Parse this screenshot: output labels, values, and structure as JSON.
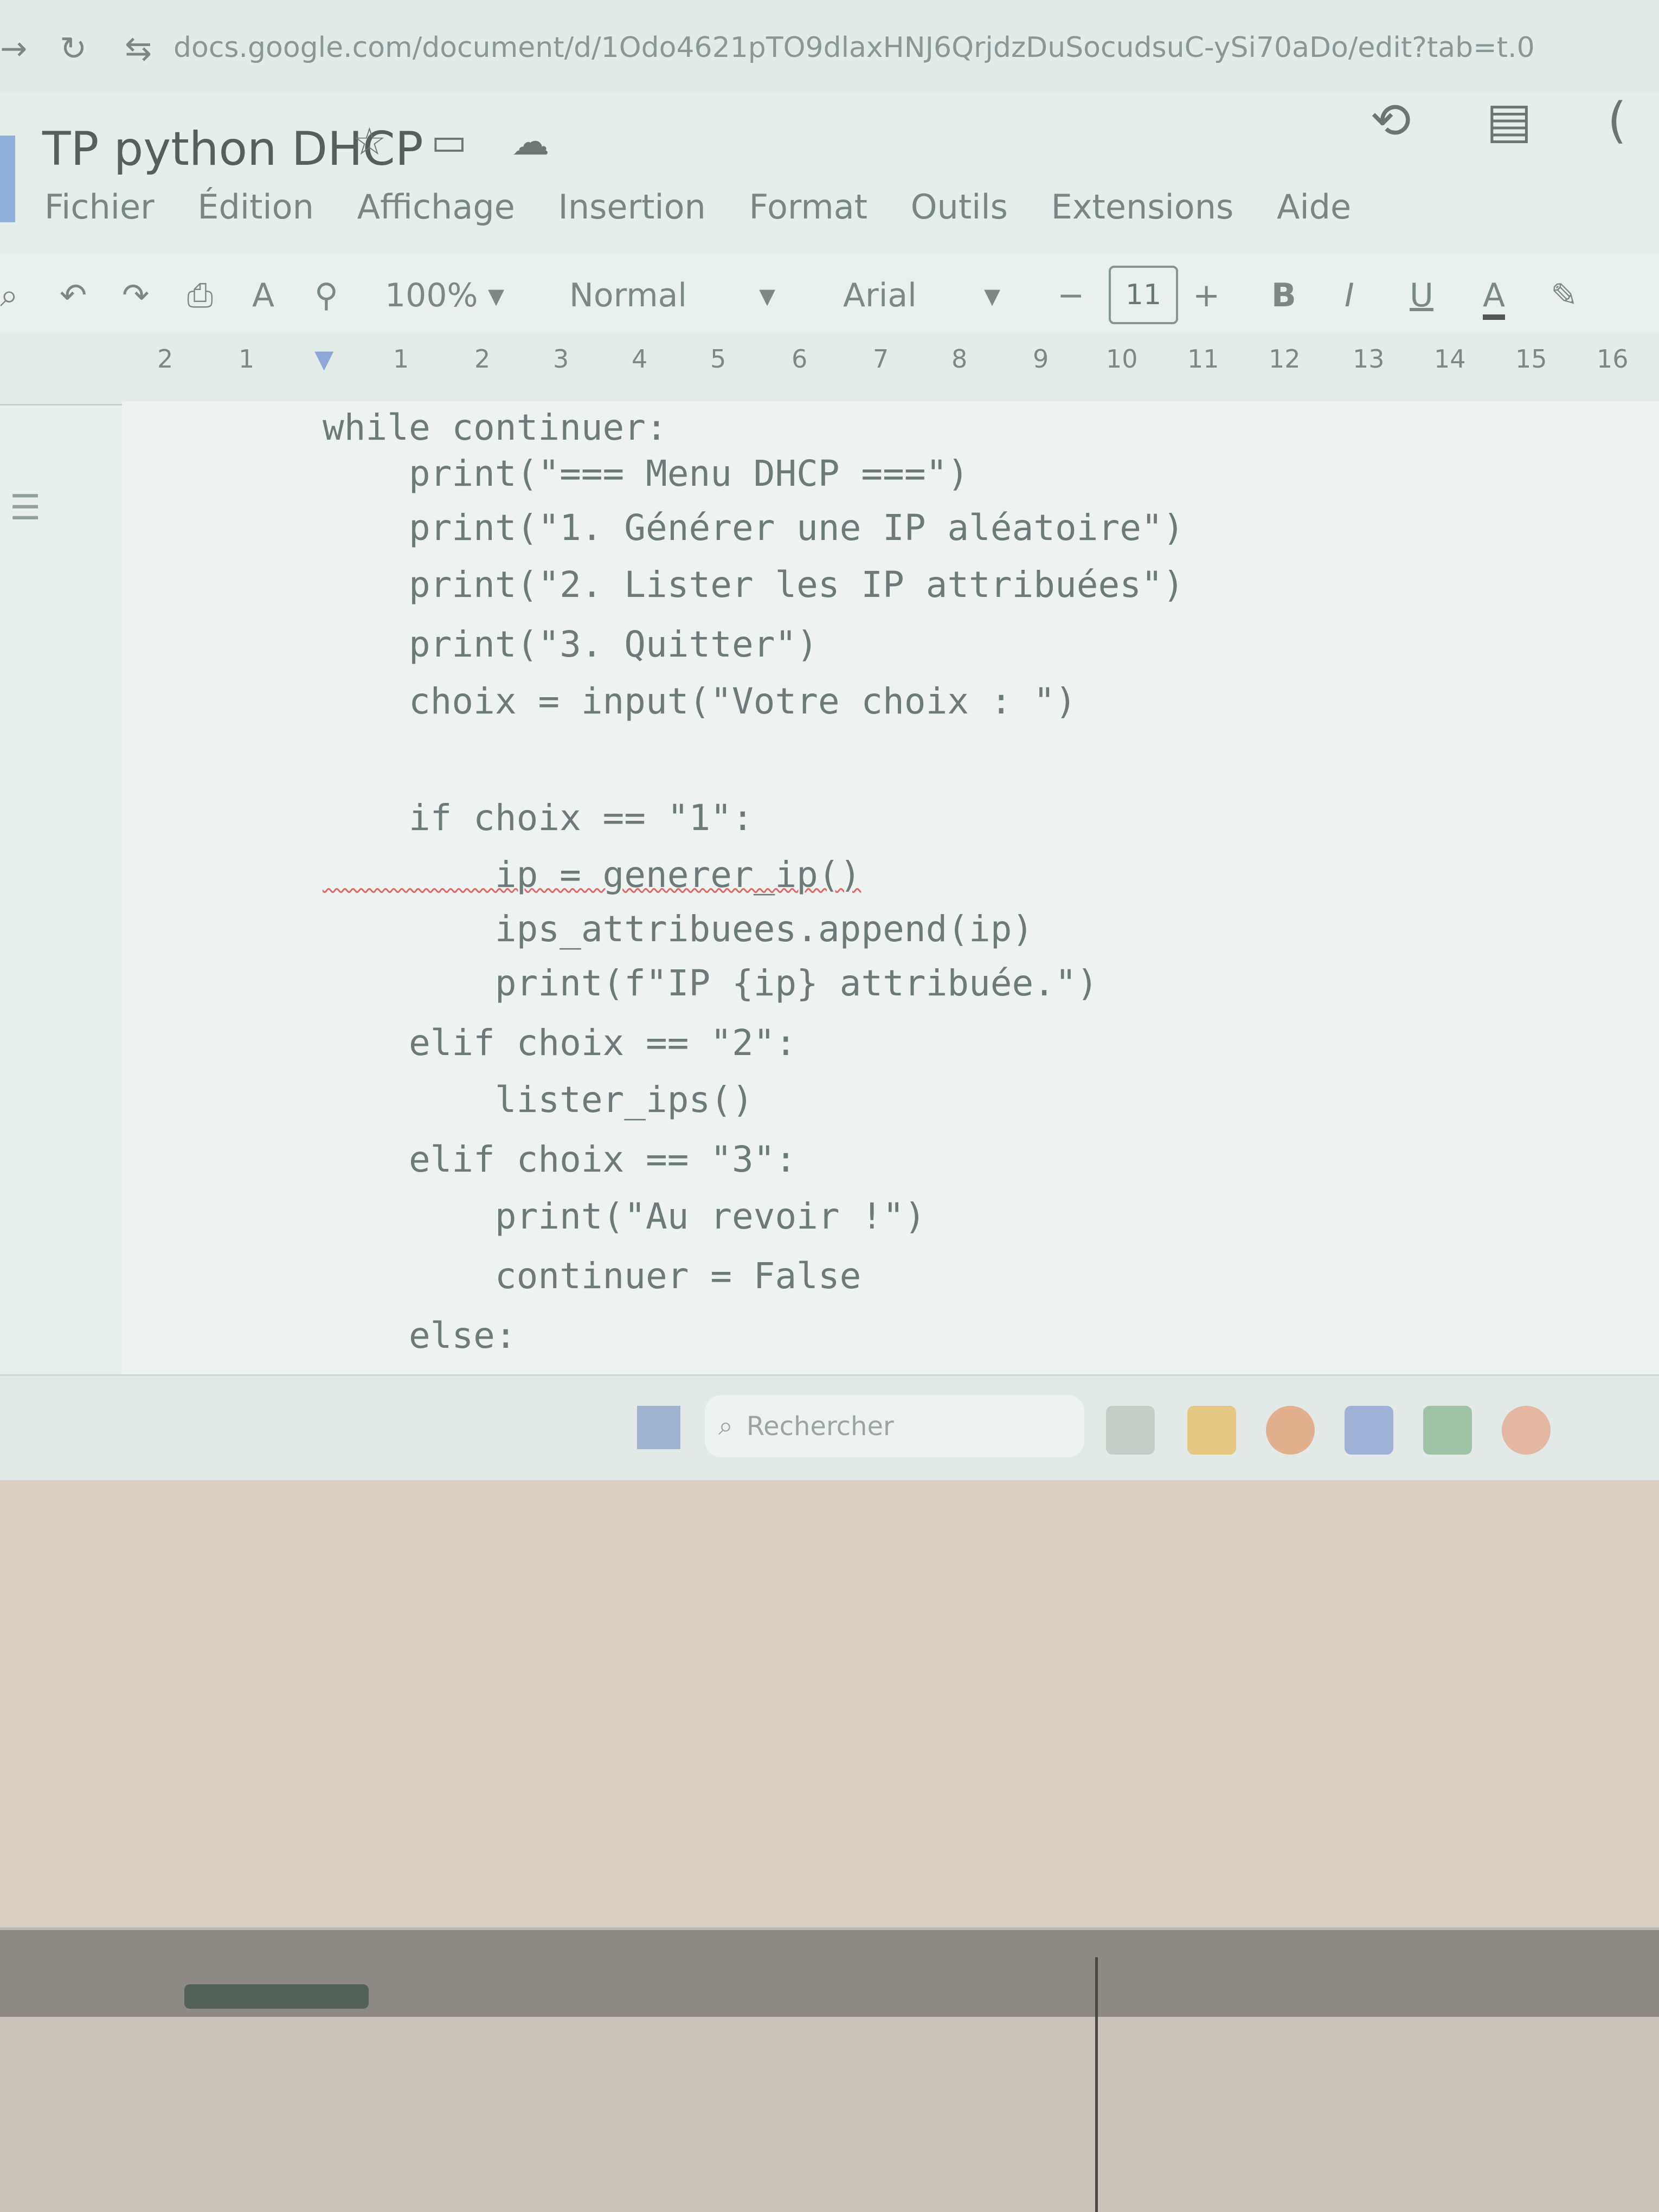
{
  "browser": {
    "url": "docs.google.com/document/d/1Odo4621pTO9dlaxHNJ6QrjdzDuSocudsuC-ySi70aDo/edit?tab=t.0"
  },
  "document": {
    "title": "TP python DHCP",
    "menu": [
      "Fichier",
      "Édition",
      "Affichage",
      "Insertion",
      "Format",
      "Outils",
      "Extensions",
      "Aide"
    ]
  },
  "toolbar": {
    "zoom": "100%",
    "style": "Normal",
    "font": "Arial",
    "font_size": "11",
    "bold": "B",
    "italic": "I",
    "underline": "U",
    "text_color": "A"
  },
  "ruler": {
    "ticks": [
      "2",
      "1",
      "1",
      "2",
      "3",
      "4",
      "5",
      "6",
      "7",
      "8",
      "9",
      "10",
      "11",
      "12",
      "13",
      "14",
      "15",
      "16"
    ]
  },
  "code": {
    "lines": [
      "while continuer:",
      "    print(\"=== Menu DHCP ===\")",
      "    print(\"1. Générer une IP aléatoire\")",
      "    print(\"2. Lister les IP attribuées\")",
      "    print(\"3. Quitter\")",
      "    choix = input(\"Votre choix : \")",
      "",
      "    if choix == \"1\":",
      "        ip = generer_ip()",
      "        ips_attribuees.append(ip)",
      "        print(f\"IP {ip} attribuée.\")",
      "    elif choix == \"2\":",
      "        lister_ips()",
      "    elif choix == \"3\":",
      "        print(\"Au revoir !\")",
      "        continuer = False",
      "    else:"
    ]
  },
  "taskbar": {
    "search_placeholder": "Rechercher"
  },
  "icons": [
    "back-icon",
    "reload-icon",
    "site-settings-icon",
    "star-icon",
    "move-to-folder-icon",
    "cloud-status-icon",
    "history-icon",
    "comments-icon",
    "search-icon",
    "undo-icon",
    "redo-icon",
    "print-icon",
    "spellcheck-icon",
    "paint-format-icon",
    "highlight-icon",
    "outline-icon",
    "windows-start-icon"
  ]
}
